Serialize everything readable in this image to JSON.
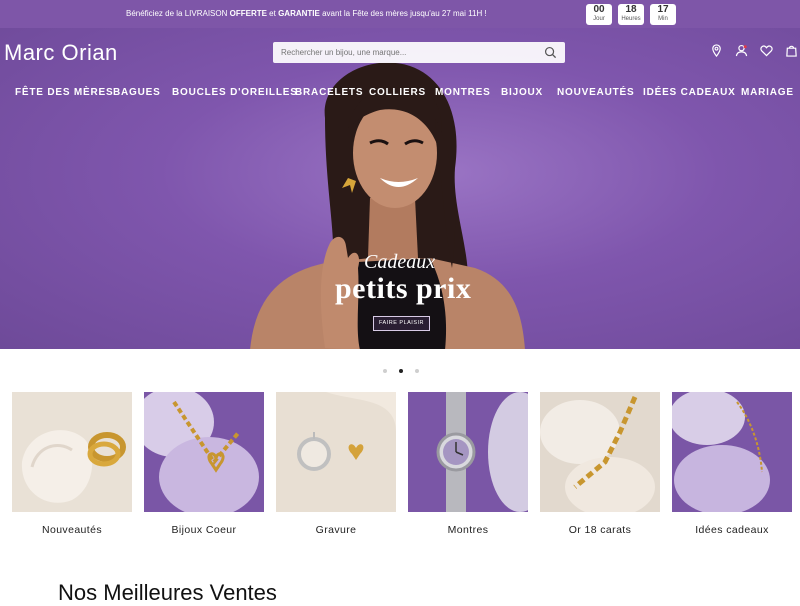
{
  "promo": {
    "text_parts": [
      "Bénéficiez de la LIVRAISON ",
      "OFFERTE",
      " et ",
      "GARANTIE",
      " avant la Fête des mères jusqu'au 27 mai 11H !"
    ],
    "countdown": [
      {
        "value": "00",
        "unit": "Jour"
      },
      {
        "value": "18",
        "unit": "Heures"
      },
      {
        "value": "17",
        "unit": "Min"
      }
    ]
  },
  "header": {
    "logo": "Marc Orian",
    "search_placeholder": "Rechercher un bijou, une marque...",
    "icons": [
      "location-icon",
      "account-icon",
      "wishlist-icon",
      "cart-icon"
    ]
  },
  "nav": [
    "FÊTE DES MÈRES",
    "BAGUES",
    "BOUCLES D'OREILLES",
    "BRACELETS",
    "COLLIERS",
    "MONTRES",
    "BIJOUX",
    "NOUVEAUTÉS",
    "IDÉES CADEAUX",
    "MARIAGE"
  ],
  "hero": {
    "caption_script": "Cadeaux",
    "caption_main": "petits prix",
    "cta": "FAIRE PLAISIR",
    "slides": 3,
    "active_slide": 2
  },
  "categories": [
    {
      "label": "Nouveautés"
    },
    {
      "label": "Bijoux Coeur"
    },
    {
      "label": "Gravure"
    },
    {
      "label": "Montres"
    },
    {
      "label": "Or 18 carats"
    },
    {
      "label": "Idées cadeaux"
    }
  ],
  "section": {
    "best_sellers_prefix": "Nos ",
    "best_sellers_main": "Meilleures Ventes"
  },
  "colors": {
    "accent": "#7e56a8",
    "hero_purple": "#8a63b8"
  }
}
